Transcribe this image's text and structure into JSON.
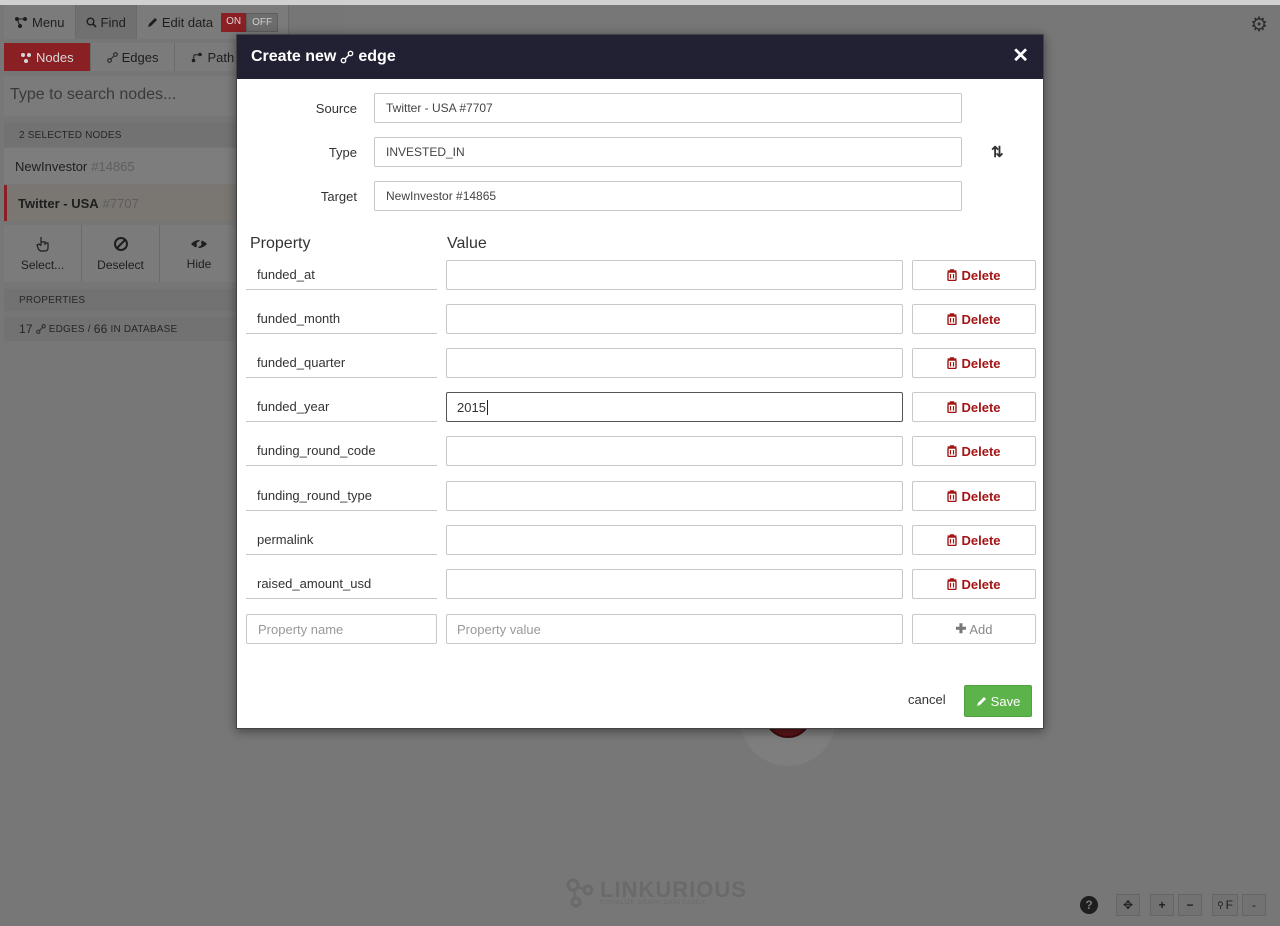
{
  "app": {
    "toolbar": {
      "menu": "Menu",
      "find": "Find",
      "edit_data": "Edit data",
      "on": "ON",
      "off": "OFF"
    },
    "tabs": [
      "Nodes",
      "Edges",
      "Path"
    ],
    "search_placeholder": "Type to search nodes...",
    "selected_header": "2 selected nodes",
    "selected_nodes": [
      {
        "name": "NewInvestor",
        "id": "#14865"
      },
      {
        "name": "Twitter - USA",
        "id": "#7707"
      }
    ],
    "actions": [
      "Select...",
      "Deselect",
      "Hide"
    ],
    "properties_header": "Properties",
    "edges_count": "17",
    "edges_label": "edges /",
    "db_count": "66",
    "db_label": "in database",
    "logo": "LINKURIOUS",
    "logo_tagline": "VISUALIZE GRAPH DATA EASILY",
    "bottom_tools": [
      "+",
      "−",
      "F",
      "-"
    ]
  },
  "modal": {
    "title_prefix": "Create new",
    "title_suffix": "edge",
    "source_label": "Source",
    "source_value": "Twitter - USA #7707",
    "type_label": "Type",
    "type_value": "INVESTED_IN",
    "target_label": "Target",
    "target_value": "NewInvestor #14865",
    "property_header": "Property",
    "value_header": "Value",
    "delete_label": "Delete",
    "properties": [
      {
        "name": "funded_at",
        "value": ""
      },
      {
        "name": "funded_month",
        "value": ""
      },
      {
        "name": "funded_quarter",
        "value": ""
      },
      {
        "name": "funded_year",
        "value": "2015"
      },
      {
        "name": "funding_round_code",
        "value": ""
      },
      {
        "name": "funding_round_type",
        "value": ""
      },
      {
        "name": "permalink",
        "value": ""
      },
      {
        "name": "raised_amount_usd",
        "value": ""
      }
    ],
    "new_name_placeholder": "Property name",
    "new_value_placeholder": "Property value",
    "add_label": "Add",
    "cancel_label": "cancel",
    "save_label": "Save"
  }
}
